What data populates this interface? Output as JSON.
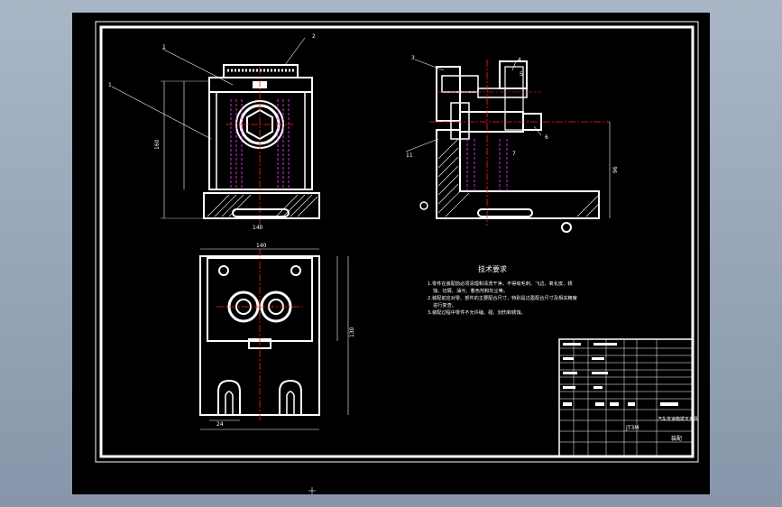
{
  "colors": {
    "background": "#000000",
    "outline": "#ffffff",
    "centerline": "#ff2020",
    "hidden": "#ff40ff",
    "dimension": "#ffffff"
  },
  "callouts": {
    "front_top_left": "1",
    "front_top_right": "2",
    "front_side": "1",
    "side_top": "3",
    "side_tr1": "4",
    "side_tr2": "5",
    "side_right": "6",
    "side_left": "11",
    "side_center": "7"
  },
  "notes": {
    "title": "技术要求",
    "line1": "1.零件在装配前必须清理和清洗干净，不得有毛刺、飞边、氧化皮、锈",
    "line2": "蚀、切屑、油污、着色剂和灰尘等。",
    "line3": "2.装配前应对零、部件的主要配合尺寸，特别是过盈配合尺寸及相关精度",
    "line4": "进行复查。",
    "line5": "3.装配过程中零件不允许磕、碰、划伤和锈蚀。"
  },
  "title_block": {
    "drawing_no": "JT3M",
    "name": "汽车变速箱拨叉夹具",
    "sub": "装配"
  },
  "dimensions": {
    "front_width": "140",
    "front_height": "160",
    "side_height": "96",
    "plan_width": "140",
    "plan_height": "130",
    "plan_slot": "24"
  }
}
